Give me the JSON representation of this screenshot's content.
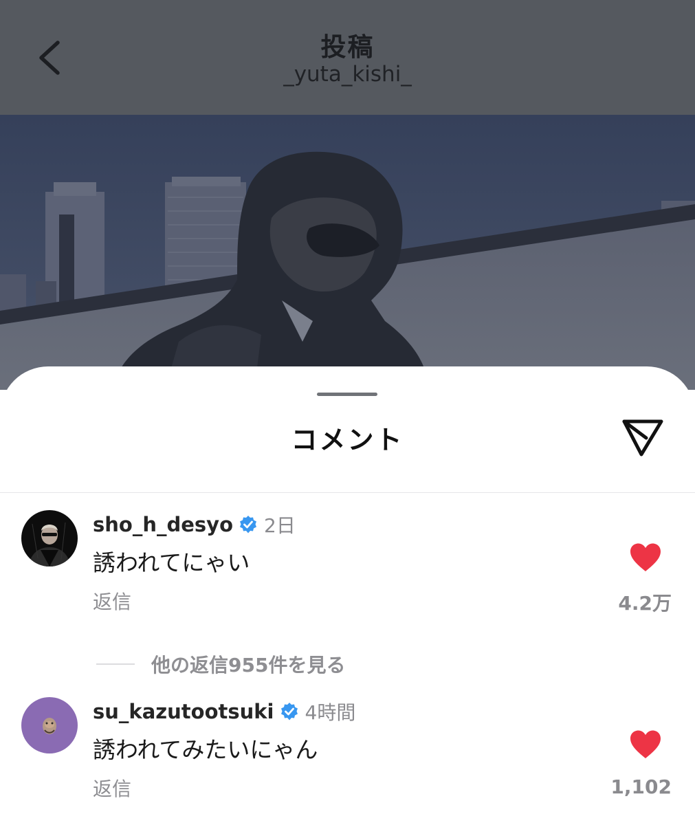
{
  "header": {
    "title": "投稿",
    "username": "_yuta_kishi_"
  },
  "sheet": {
    "title": "コメント"
  },
  "comments": [
    {
      "username": "sho_h_desyo",
      "verified": true,
      "time": "2日",
      "text": "誘われてにゃい",
      "reply_label": "返信",
      "like_count": "4.2万",
      "liked": true,
      "more_replies": "他の返信955件を見る"
    },
    {
      "username": "su_kazutootsuki",
      "verified": true,
      "time": "4時間",
      "text": "誘われてみたいにゃん",
      "reply_label": "返信",
      "like_count": "1,102",
      "liked": true
    }
  ],
  "icons": {
    "back": "chevron-left-icon",
    "share": "paper-plane-icon",
    "verified": "verified-badge-icon",
    "like": "heart-icon"
  },
  "colors": {
    "header_overlay": "#55595f",
    "verified_blue": "#3897f0",
    "heart_red": "#ed3445",
    "secondary_text": "#8e8e92"
  }
}
